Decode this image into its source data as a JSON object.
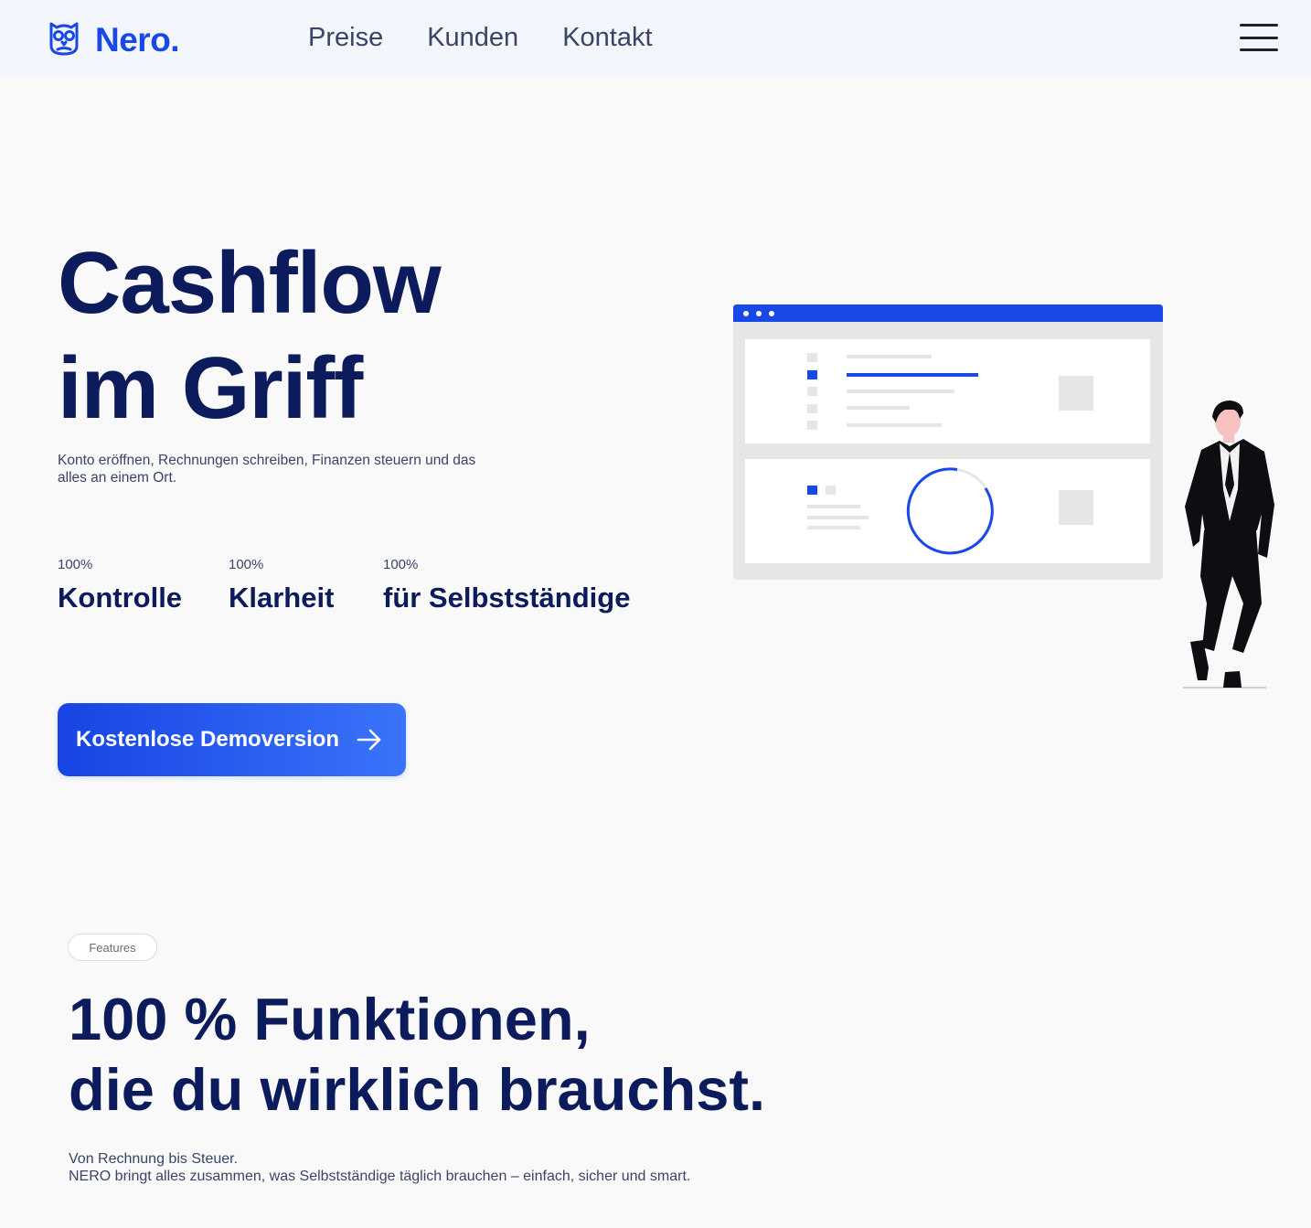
{
  "header": {
    "brand": "Nero.",
    "nav": [
      {
        "label": "Preise"
      },
      {
        "label": "Kunden"
      },
      {
        "label": "Kontakt"
      }
    ]
  },
  "hero": {
    "title_line1": "Cashflow",
    "title_line2": "im Griff",
    "subtitle": "Konto eröffnen, Rechnungen schreiben, Finanzen steuern und das alles an einem Ort.",
    "stats": [
      {
        "pct": "100%",
        "label": "Kontrolle"
      },
      {
        "pct": "100%",
        "label": "Klarheit"
      },
      {
        "pct": "100%",
        "label": "für Selbstständige"
      }
    ],
    "cta_label": "Kostenlose Demoversion"
  },
  "features": {
    "badge": "Features",
    "title_line1": "100 % Funktionen,",
    "title_line2": "die du wirklich brauchst.",
    "desc_line1": "Von Rechnung bis Steuer.",
    "desc_line2": "NERO bringt alles zusammen, was Selbstständige täglich brauchen – einfach, sicher und smart."
  },
  "colors": {
    "brand": "#1848e5",
    "heading": "#0b1b5b",
    "text": "#3a4466",
    "background": "#f9f9fa",
    "header_bg": "#f3f6fc"
  },
  "icons": {
    "logo": "owl-icon",
    "menu": "hamburger-menu-icon",
    "cta": "arrow-right-icon"
  }
}
